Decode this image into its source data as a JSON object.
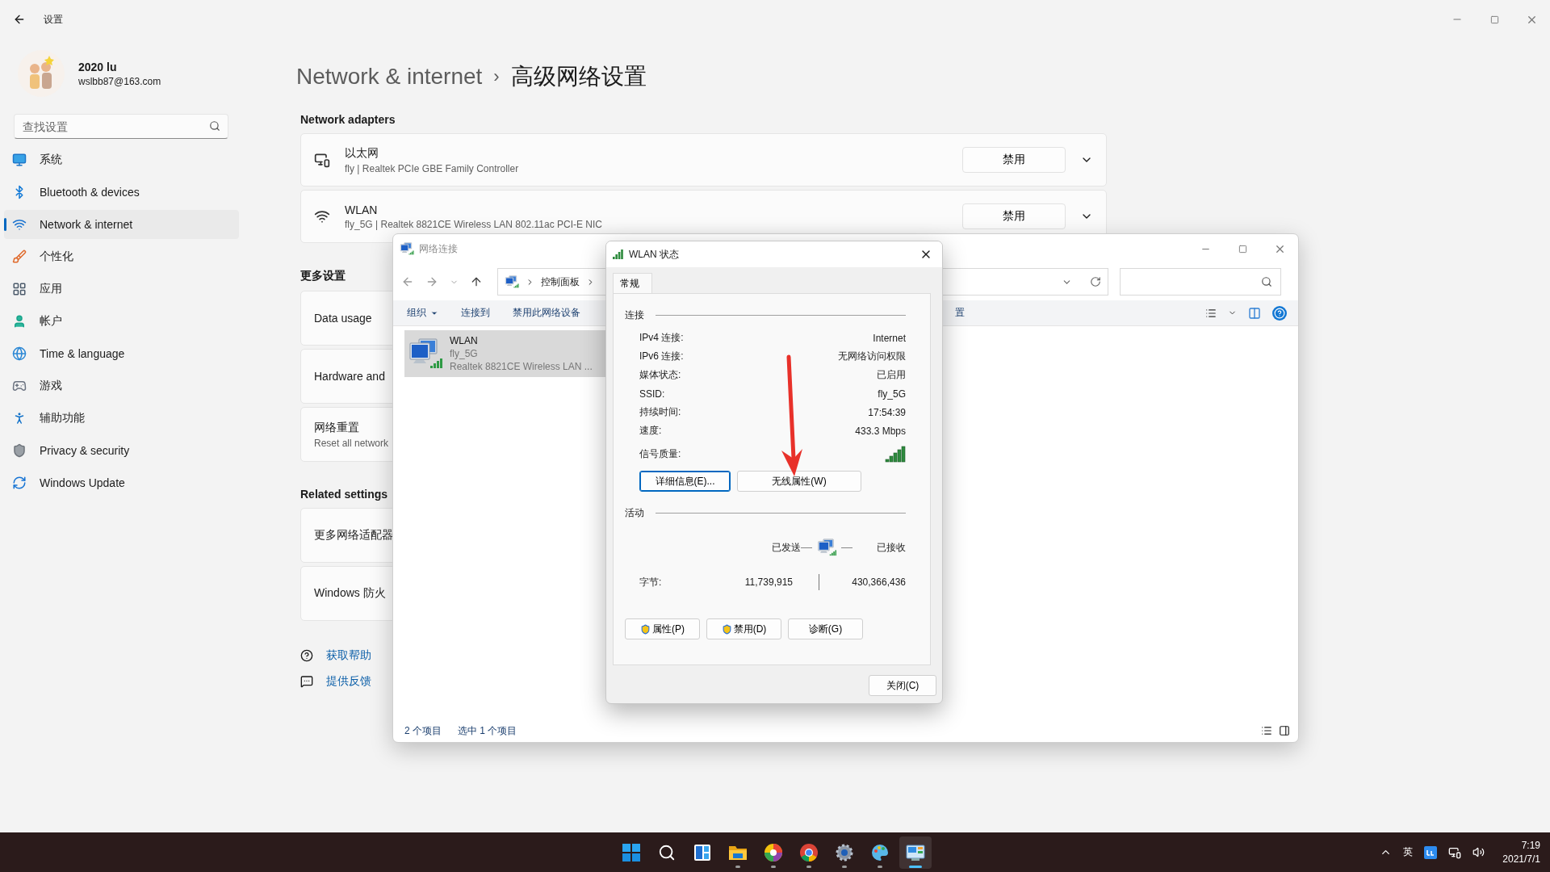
{
  "settings": {
    "title": "设置",
    "user": {
      "name": "2020 lu",
      "email": "wslbb87@163.com"
    },
    "search": {
      "placeholder": "查找设置"
    },
    "nav": [
      {
        "label": "系统",
        "selected": false
      },
      {
        "label": "Bluetooth & devices",
        "selected": false
      },
      {
        "label": "Network & internet",
        "selected": true
      },
      {
        "label": "个性化",
        "selected": false
      },
      {
        "label": "应用",
        "selected": false
      },
      {
        "label": "帐户",
        "selected": false
      },
      {
        "label": "Time & language",
        "selected": false
      },
      {
        "label": "游戏",
        "selected": false
      },
      {
        "label": "辅助功能",
        "selected": false
      },
      {
        "label": "Privacy & security",
        "selected": false
      },
      {
        "label": "Windows Update",
        "selected": false
      }
    ],
    "breadcrumb": {
      "parent": "Network & internet",
      "separator": "›",
      "current": "高级网络设置"
    },
    "sections": [
      {
        "heading": "Network adapters",
        "cards": [
          {
            "kind": "adapter",
            "title": "以太网",
            "subtitle": "fly | Realtek PCIe GBE Family Controller",
            "button": "禁用"
          },
          {
            "kind": "adapter",
            "title": "WLAN",
            "subtitle": "fly_5G | Realtek 8821CE Wireless LAN 802.11ac PCI-E NIC",
            "button": "禁用"
          }
        ]
      },
      {
        "heading": "更多设置",
        "cards": [
          {
            "kind": "link",
            "title": "Data usage"
          },
          {
            "kind": "link",
            "title": "Hardware and"
          },
          {
            "kind": "link",
            "title": "网络重置",
            "subtitle": "Reset all network"
          }
        ]
      },
      {
        "heading": "Related settings",
        "cards": [
          {
            "kind": "link",
            "title": "更多网络适配器"
          },
          {
            "kind": "link",
            "title": "Windows 防火"
          }
        ]
      }
    ],
    "links": [
      "获取帮助",
      "提供反馈"
    ]
  },
  "explorer": {
    "title": "网络连接",
    "address": [
      "控制面板"
    ],
    "toolbar": [
      {
        "label": "组织",
        "dropdown": true
      },
      {
        "label": "连接到",
        "dropdown": false
      },
      {
        "label": "禁用此网络设备",
        "dropdown": false
      }
    ],
    "toolbar_cut": "置",
    "items": [
      {
        "name": "WLAN",
        "network": "fly_5G",
        "adapter": "Realtek 8821CE Wireless LAN ...",
        "selected": true
      }
    ],
    "status": [
      "2 个项目",
      "选中 1 个项目"
    ]
  },
  "dialog": {
    "title": "WLAN 状态",
    "tabs": [
      {
        "label": "常规",
        "selected": true
      }
    ],
    "connection": {
      "heading": "连接",
      "rows": [
        {
          "label": "IPv4 连接:",
          "value": "Internet"
        },
        {
          "label": "IPv6 连接:",
          "value": "无网络访问权限"
        },
        {
          "label": "媒体状态:",
          "value": "已启用"
        },
        {
          "label": "SSID:",
          "value": "fly_5G"
        },
        {
          "label": "持续时间:",
          "value": "17:54:39"
        },
        {
          "label": "速度:",
          "value": "433.3 Mbps"
        }
      ],
      "signal_label": "信号质量:",
      "buttons": [
        {
          "label": "详细信息(E)...",
          "focused": true
        },
        {
          "label": "无线属性(W)",
          "focused": false
        }
      ]
    },
    "activity": {
      "heading": "活动",
      "sent": "已发送",
      "received": "已接收",
      "bytes_label": "字节:",
      "bytes_sent": "11,739,915",
      "bytes_received": "430,366,436"
    },
    "buttons": [
      {
        "label": "属性(P)",
        "shield": true
      },
      {
        "label": "禁用(D)",
        "shield": true
      },
      {
        "label": "诊断(G)",
        "shield": false
      }
    ],
    "close": "关闭(C)"
  },
  "taskbar": {
    "apps": [
      {
        "kind": "start",
        "running": false,
        "selected": false
      },
      {
        "kind": "search",
        "running": false,
        "selected": false
      },
      {
        "kind": "widgets",
        "running": false,
        "selected": false
      },
      {
        "kind": "folder",
        "running": true,
        "selected": false
      },
      {
        "kind": "pinwheel",
        "running": true,
        "selected": false
      },
      {
        "kind": "browser",
        "running": true,
        "selected": false
      },
      {
        "kind": "gear",
        "running": true,
        "selected": false
      },
      {
        "kind": "palette",
        "running": true,
        "selected": false
      },
      {
        "kind": "panel",
        "running": true,
        "selected": true
      }
    ],
    "ime": "英",
    "time": "7:19",
    "date": "2021/7/1"
  }
}
